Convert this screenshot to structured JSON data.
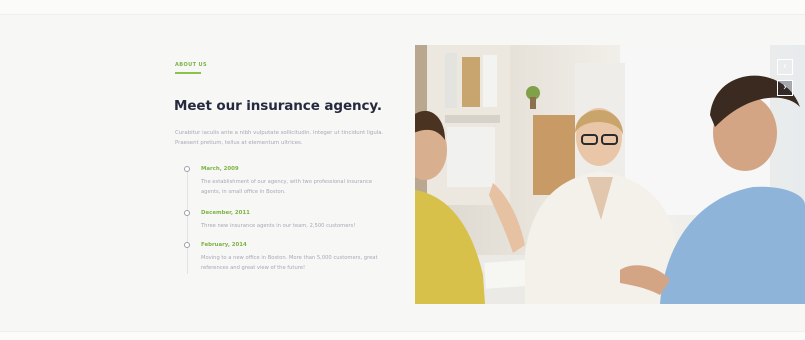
{
  "section": {
    "eyebrow": "ABOUT US",
    "title": "Meet our insurance agency.",
    "intro": "Curabitur iaculis ante a nibh vulputate sollicitudin. Integer ut tincidunt ligula. Praesent pretium, tellus at elementum ultrices."
  },
  "timeline": [
    {
      "date": "March, 2009",
      "text": "The establishment of our agency, with two professional insurance agents, in small office in Boston."
    },
    {
      "date": "December, 2011",
      "text": "Three new insurance agents in our team, 2,500 customers!"
    },
    {
      "date": "February, 2014",
      "text": "Moving to a new office in Boston. More than 5,000 customers, great references and great view of the future!"
    }
  ],
  "slider": {
    "prev_label": "‹",
    "next_label": "›"
  },
  "colors": {
    "accent": "#7cb342",
    "title": "#252a3f",
    "body_text": "#a6a9b4"
  },
  "icons": [
    "chevron-left-icon",
    "chevron-right-icon",
    "timeline-dot-icon"
  ]
}
